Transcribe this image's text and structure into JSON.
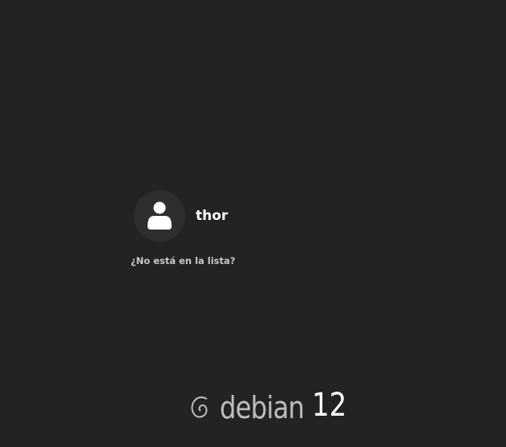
{
  "user_list": {
    "users": [
      {
        "name": "thor",
        "avatar_icon": "person-icon"
      }
    ],
    "not_listed_label": "¿No está en la lista?"
  },
  "branding": {
    "logo_text": "debian",
    "version": "12",
    "logo_icon": "debian-swirl-icon"
  }
}
